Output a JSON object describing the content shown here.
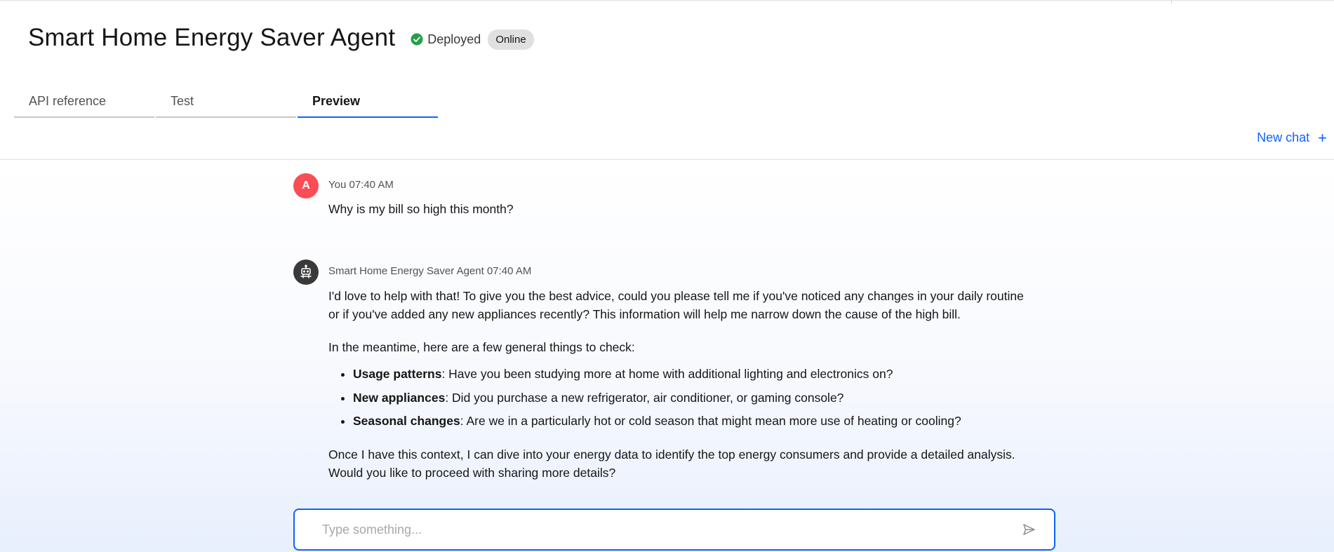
{
  "header": {
    "title": "Smart Home Energy Saver Agent",
    "status_label": "Deployed",
    "badge": "Online",
    "status_color": "#24a148"
  },
  "tabs": [
    {
      "label": "API reference",
      "active": false
    },
    {
      "label": "Test",
      "active": false
    },
    {
      "label": "Preview",
      "active": true
    }
  ],
  "toolbar": {
    "new_chat_label": "New chat",
    "new_chat_icon": "+"
  },
  "messages": [
    {
      "author": "You",
      "avatar_letter": "A",
      "time": "07:40 AM",
      "text": "Why is my bill so high this month?"
    },
    {
      "author": "Smart Home Energy Saver Agent",
      "time": "07:40 AM",
      "intro": "I'd love to help with that! To give you the best advice, could you please tell me if you've noticed any changes in your daily routine or if you've added any new appliances recently? This information will help me narrow down the cause of the high bill.",
      "lead": "In the meantime, here are a few general things to check:",
      "bullets": [
        {
          "title": "Usage patterns",
          "text": ": Have you been studying more at home with additional lighting and electronics on?"
        },
        {
          "title": "New appliances",
          "text": ": Did you purchase a new refrigerator, air conditioner, or gaming console?"
        },
        {
          "title": "Seasonal changes",
          "text": ": Are we in a particularly hot or cold season that might mean more use of heating or cooling?"
        }
      ],
      "closing": "Once I have this context, I can dive into your energy data to identify the top energy consumers and provide a detailed analysis. Would you like to proceed with sharing more details?"
    }
  ],
  "composer": {
    "placeholder": "Type something...",
    "value": ""
  },
  "colors": {
    "accent": "#0f62fe",
    "user_avatar": "#fa4d56",
    "bot_avatar": "#393939"
  }
}
